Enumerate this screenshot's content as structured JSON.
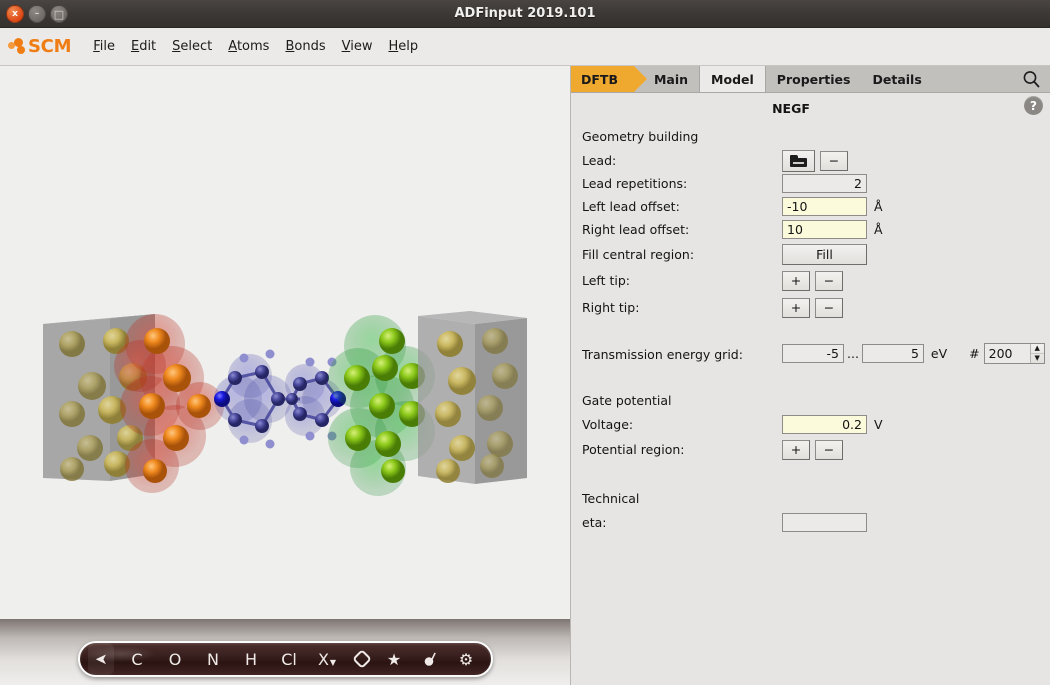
{
  "window": {
    "title": "ADFinput 2019.101",
    "buttons": {
      "close": "x",
      "minimize": "–",
      "maximize": "□"
    }
  },
  "menubar": {
    "logo_text": "SCM",
    "items": [
      {
        "label": "File",
        "accel": "F"
      },
      {
        "label": "Edit",
        "accel": "E"
      },
      {
        "label": "Select",
        "accel": "S"
      },
      {
        "label": "Atoms",
        "accel": "A"
      },
      {
        "label": "Bonds",
        "accel": "B"
      },
      {
        "label": "View",
        "accel": "V"
      },
      {
        "label": "Help",
        "accel": "H"
      }
    ]
  },
  "tabs": {
    "items": [
      {
        "label": "DFTB",
        "style": "module",
        "active": false
      },
      {
        "label": "Main",
        "style": "plain",
        "active": false
      },
      {
        "label": "Model",
        "style": "plain",
        "active": true
      },
      {
        "label": "Properties",
        "style": "plain",
        "active": false
      },
      {
        "label": "Details",
        "style": "plain",
        "active": false
      }
    ],
    "search_icon": "search-icon"
  },
  "panel": {
    "title": "NEGF",
    "help_label": "?"
  },
  "sections": {
    "geometry_building": "Geometry building",
    "gate_potential": "Gate potential",
    "technical": "Technical"
  },
  "fields": {
    "lead": {
      "label": "Lead:",
      "browse_icon": "folder-icon",
      "remove_label": "−"
    },
    "lead_repetitions": {
      "label": "Lead repetitions:",
      "value": "2"
    },
    "left_lead_offset": {
      "label": "Left lead offset:",
      "value": "-10",
      "unit": "Å"
    },
    "right_lead_offset": {
      "label": "Right lead offset:",
      "value": "10",
      "unit": "Å"
    },
    "fill_central_region": {
      "label": "Fill central region:",
      "button": "Fill"
    },
    "left_tip": {
      "label": "Left tip:",
      "add": "+",
      "remove": "−"
    },
    "right_tip": {
      "label": "Right tip:",
      "add": "+",
      "remove": "−"
    },
    "transmission_energy_grid": {
      "label": "Transmission energy grid:",
      "from": "-5",
      "separator": "...",
      "to": "5",
      "unit": "eV",
      "count_prefix": "#",
      "count": "200"
    },
    "voltage": {
      "label": "Voltage:",
      "value": "0.2",
      "unit": "V"
    },
    "potential_region": {
      "label": "Potential region:",
      "add": "+",
      "remove": "−"
    },
    "eta": {
      "label": "eta:",
      "value": ""
    }
  },
  "atom_toolbar": {
    "buttons": [
      {
        "name": "select-cursor",
        "label": "➤",
        "kind": "cursor",
        "selected": true
      },
      {
        "name": "element-c",
        "label": "C",
        "kind": "text",
        "selected": false
      },
      {
        "name": "element-o",
        "label": "O",
        "kind": "text",
        "selected": false
      },
      {
        "name": "element-n",
        "label": "N",
        "kind": "text",
        "selected": false
      },
      {
        "name": "element-h",
        "label": "H",
        "kind": "text",
        "selected": false
      },
      {
        "name": "element-cl",
        "label": "Cl",
        "kind": "text",
        "selected": false
      },
      {
        "name": "element-other",
        "label": "X",
        "kind": "dropdown",
        "selected": false
      },
      {
        "name": "ring-tool",
        "label": "",
        "kind": "ring",
        "selected": false
      },
      {
        "name": "favorites",
        "label": "★",
        "kind": "text",
        "selected": false
      },
      {
        "name": "pointer-tool",
        "label": "⭘",
        "kind": "tadpole",
        "selected": false
      },
      {
        "name": "settings-gear",
        "label": "⚙",
        "kind": "text",
        "selected": false
      }
    ]
  },
  "viewer": {
    "description": "Molecular structure: gold lead electrodes with red and green highlighted contact regions and a central blue organic molecule",
    "colors": {
      "background": "#efefee",
      "gold": "#c9b24a",
      "orange": "#e8821e",
      "red_halo": "#c0392b",
      "green": "#7ec11c",
      "green_halo": "#2f9e44",
      "molecule_blue": "#4a4aa8",
      "box_gray": "#8c8c8c"
    }
  }
}
